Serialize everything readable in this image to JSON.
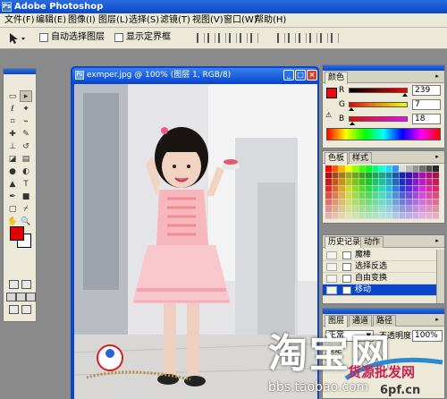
{
  "app": {
    "title": "Adobe Photoshop",
    "icon": "photoshop-icon"
  },
  "menu": {
    "items": [
      "文件(F)",
      "编辑(E)",
      "图像(I)",
      "图层(L)",
      "选择(S)",
      "滤镜(T)",
      "视图(V)",
      "窗口(W)",
      "帮助(H)"
    ]
  },
  "options": {
    "auto_select_layer": "自动选择图层",
    "show_bounding_box": "显示定界框"
  },
  "document": {
    "title": "exmper.jpg @ 100% (图层 1, RGB/8)"
  },
  "color_panel": {
    "tab": "颜色",
    "r_label": "R",
    "g_label": "G",
    "b_label": "B",
    "r_value": "239",
    "g_value": "7",
    "b_value": "18",
    "foreground_color": "#ef0712"
  },
  "swatches_panel": {
    "tabs": [
      "色板",
      "样式"
    ]
  },
  "history_panel": {
    "tabs": [
      "历史记录",
      "动作"
    ],
    "items": [
      "魔棒",
      "选择反选",
      "自由变换",
      "移动"
    ],
    "selected_index": 3
  },
  "layers_panel": {
    "tabs": [
      "图层",
      "通道",
      "路径"
    ],
    "blend_mode": "正常",
    "opacity_label": "不透明度:",
    "opacity_value": "100%",
    "lock_label": "锁定"
  },
  "watermark": {
    "logo_text": "淘宝网",
    "site_url": "bbs.taobao.com",
    "brand_text": "货源批发网",
    "brand_url": "6pf.cn"
  },
  "colors": {
    "accent": "#0a46c8",
    "titlebar": "#0a46c8",
    "panel_bg": "#ece9d8",
    "workspace": "#8a8a8a"
  }
}
